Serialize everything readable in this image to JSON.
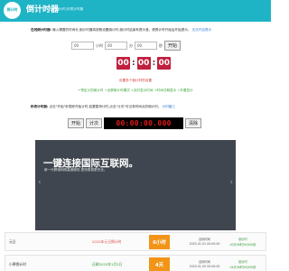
{
  "header": {
    "logo_text": "倒计时",
    "title": "倒计时器",
    "subtitle": "在线倒计时,秒表计时器"
  },
  "countdown_section": {
    "label": "在线倒计时器:",
    "description": "输入需要的时间长,倒计时器将按照设置倒计时,倒计时结束有提示音。便携计时开始后开始提示。",
    "link_text": "无法开启提示"
  },
  "form": {
    "hours_value": "00",
    "hours_unit": "小时",
    "minutes_value": "00",
    "minutes_unit": "分",
    "seconds_value": "00",
    "seconds_unit": "秒",
    "start_label": "开始"
  },
  "countdown_display": {
    "hours": "00",
    "minutes": "00",
    "seconds": "00"
  },
  "hint_text": "设置多个倒计时的设置",
  "options_text": "+预定义的倒计时  +全屏倒计时模式  +实时显示时间  +时间日期显示  +外置显示",
  "stopwatch_section": {
    "label": "秒表计时器:",
    "description": "点击\"开始\"秒表即开始计时,若要暂停计时,点击\"计次\"可记录时间点的倒计时。",
    "link_text": "分时器工"
  },
  "stopwatch": {
    "start_label": "开始",
    "lap_label": "计次",
    "display": "00:00:00.000",
    "clear_label": "清除"
  },
  "banner": {
    "title": "一键连接国际互联网。",
    "subtitle": "新一代跨境网络高速服务,更快更稳更安全。",
    "prev_icon": "‹",
    "next_icon": "›"
  },
  "countdown_list": [
    {
      "name": "元旦",
      "date": "2025年元旦倒计时",
      "remaining": "6小时",
      "target_label": "目标时间",
      "target_time": "2025-01-01 00:00:00",
      "countdown_label": "倒计时",
      "countdown_value": "00天06时00分00秒"
    },
    {
      "name": "小寒倒计时",
      "date": "还剩2025年1月5日",
      "remaining": "4天",
      "target_label": "目标时间",
      "target_time": "2025-01-05 00:00:00",
      "countdown_label": "倒计时",
      "countdown_value": "04天06时00分00秒"
    }
  ],
  "colors": {
    "header_bg": "#1fb3c6",
    "countdown_box": "#c0203f",
    "stopwatch_bg": "#000000",
    "stopwatch_text": "#e01818",
    "badge": "#f29418",
    "banner_bg": "#40464f",
    "hint": "#d23c3c",
    "options": "#3fa63f"
  }
}
